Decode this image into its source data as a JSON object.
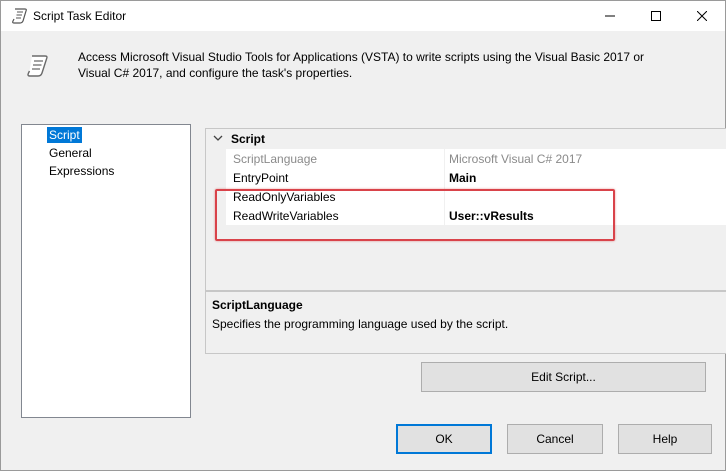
{
  "window": {
    "title": "Script Task Editor"
  },
  "header": {
    "description": "Access Microsoft Visual Studio Tools for Applications (VSTA) to write scripts using the Visual Basic 2017 or Visual C# 2017, and configure the task's properties."
  },
  "nav": {
    "items": [
      {
        "label": "Script",
        "selected": true
      },
      {
        "label": "General",
        "selected": false
      },
      {
        "label": "Expressions",
        "selected": false
      }
    ]
  },
  "properties": {
    "category": "Script",
    "rows": [
      {
        "name": "ScriptLanguage",
        "value": "Microsoft Visual C# 2017"
      },
      {
        "name": "EntryPoint",
        "value": "Main"
      },
      {
        "name": "ReadOnlyVariables",
        "value": ""
      },
      {
        "name": "ReadWriteVariables",
        "value": "User::vResults"
      }
    ]
  },
  "description_panel": {
    "title": "ScriptLanguage",
    "text": "Specifies the programming language used by the script."
  },
  "buttons": {
    "edit_script": "Edit Script...",
    "ok": "OK",
    "cancel": "Cancel",
    "help": "Help"
  },
  "colors": {
    "selection": "#0078d7",
    "highlight_box": "#d9434a"
  }
}
